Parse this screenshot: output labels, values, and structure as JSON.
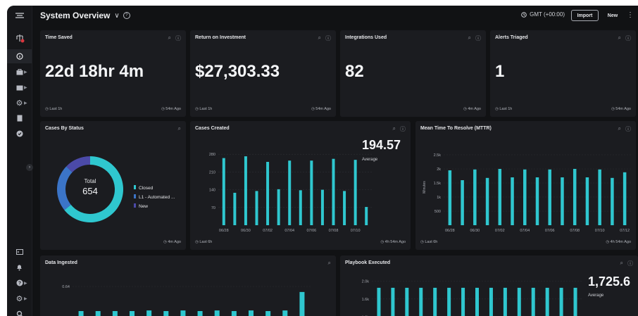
{
  "header": {
    "title": "System Overview",
    "timezone": "GMT (+00:00)",
    "import_label": "Import",
    "new_label": "New"
  },
  "sidebar": {
    "items": [
      {
        "icon": "add-workflow-icon"
      },
      {
        "icon": "info-icon",
        "active": true
      },
      {
        "icon": "briefcase-icon"
      },
      {
        "icon": "folders-icon"
      },
      {
        "icon": "gear-icon"
      },
      {
        "icon": "document-icon"
      },
      {
        "icon": "check-circle-icon"
      },
      {
        "icon": "terminal-icon"
      },
      {
        "icon": "bell-icon"
      },
      {
        "icon": "help-icon"
      },
      {
        "icon": "settings-icon"
      }
    ]
  },
  "kpis": [
    {
      "title": "Time Saved",
      "value": "22d 18hr 4m",
      "footer_left": "Last 1h",
      "footer_right": "54m Ago"
    },
    {
      "title": "Return on Investment",
      "value": "$27,303.33",
      "footer_left": "Last 1h",
      "footer_right": "54m Ago"
    },
    {
      "title": "Integrations Used",
      "value": "82",
      "footer_left": "",
      "footer_right": "4m Ago"
    },
    {
      "title": "Alerts Triaged",
      "value": "1",
      "footer_left": "Last 1h",
      "footer_right": "54m Ago"
    }
  ],
  "cases_by_status": {
    "title": "Cases By Status",
    "total_label": "Total",
    "total_value": "654",
    "footer_right": "4m Ago",
    "legend": [
      {
        "label": "Closed",
        "color": "#2fc7cf"
      },
      {
        "label": "L1 - Automated ...",
        "color": "#3b74c7"
      },
      {
        "label": "New",
        "color": "#4b4aa8"
      }
    ]
  },
  "cases_created": {
    "title": "Cases Created",
    "average_value": "194.57",
    "average_label": "Average",
    "footer_left": "Last 6h",
    "footer_right": "4h 54m Ago"
  },
  "mttr": {
    "title": "Mean Time To Resolve (MTTR)",
    "footer_left": "Last 6h",
    "footer_right": "4h 54m Ago"
  },
  "data_ingested": {
    "title": "Data Ingested"
  },
  "playbook_executed": {
    "title": "Playbook Executed",
    "average_value": "1,725.6",
    "average_label": "Average"
  },
  "chart_data": [
    {
      "type": "pie",
      "title": "Cases By Status",
      "categories": [
        "Closed",
        "L1 - Automated ...",
        "New"
      ],
      "values": [
        420,
        150,
        84
      ],
      "colors": [
        "#2fc7cf",
        "#3b74c7",
        "#4b4aa8"
      ]
    },
    {
      "type": "bar",
      "title": "Cases Created",
      "categories": [
        "06/28",
        "06/29",
        "06/30",
        "07/01",
        "07/02",
        "07/03",
        "07/04",
        "07/05",
        "07/06",
        "07/07",
        "07/08",
        "07/09",
        "07/10",
        "07/11"
      ],
      "tick_labels": [
        "06/28",
        "06/30",
        "07/02",
        "07/04",
        "07/06",
        "07/08",
        "07/10"
      ],
      "values": [
        265,
        128,
        272,
        135,
        250,
        142,
        255,
        138,
        255,
        140,
        262,
        135,
        258,
        72
      ],
      "yticks": [
        70,
        140,
        210,
        280
      ],
      "ylim": [
        0,
        300
      ],
      "color": "#2fc7cf"
    },
    {
      "type": "bar",
      "title": "Mean Time To Resolve (MTTR)",
      "ylabel": "Minutes",
      "categories": [
        "06/28",
        "06/29",
        "06/30",
        "07/01",
        "07/02",
        "07/03",
        "07/04",
        "07/05",
        "07/06",
        "07/07",
        "07/08",
        "07/09",
        "07/10",
        "07/11",
        "07/12"
      ],
      "tick_labels": [
        "06/28",
        "06/30",
        "07/02",
        "07/04",
        "07/06",
        "07/08",
        "07/10",
        "07/12"
      ],
      "values": [
        1950,
        1600,
        1980,
        1680,
        2000,
        1700,
        1980,
        1700,
        1980,
        1700,
        2000,
        1700,
        1980,
        1680,
        1880
      ],
      "yticks": [
        "500",
        "1k",
        "1.5k",
        "2k",
        "2.5k"
      ],
      "ytick_values": [
        500,
        1000,
        1500,
        2000,
        2500
      ],
      "ylim": [
        0,
        2700
      ],
      "color": "#2fc7cf"
    },
    {
      "type": "bar",
      "title": "Data Ingested",
      "yticks": [
        "0.64"
      ],
      "ytick_values": [
        0.64
      ],
      "values": [
        0.24,
        0.24,
        0.24,
        0.24,
        0.25,
        0.24,
        0.25,
        0.24,
        0.25,
        0.24,
        0.25,
        0.24,
        0.25,
        0.55
      ],
      "ylim": [
        0,
        0.8
      ],
      "color": "#2fc7cf"
    },
    {
      "type": "bar",
      "title": "Playbook Executed",
      "yticks": [
        "1.2k",
        "1.6k",
        "2.0k"
      ],
      "ytick_values": [
        1200,
        1600,
        2000
      ],
      "values": [
        1850,
        1850,
        1850,
        1850,
        1850,
        1850,
        1850,
        1850,
        1850,
        1850,
        1850,
        1850,
        1850,
        1850,
        1850
      ],
      "ylim": [
        1000,
        2100
      ],
      "color": "#2fc7cf"
    }
  ]
}
